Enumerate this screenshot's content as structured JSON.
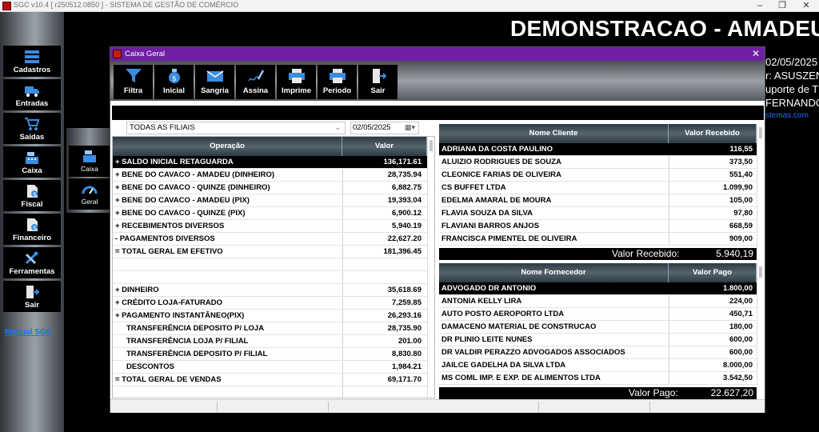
{
  "window": {
    "title": "SGC v10.4 [ r250512.0850 ] - SISTEMA DE GESTÃO DE COMÉRCIO"
  },
  "sidebar": {
    "items": [
      {
        "label": "Cadastros",
        "icon": "cadastros-icon"
      },
      {
        "label": "Entradas",
        "icon": "truck-icon"
      },
      {
        "label": "Saídas",
        "icon": "cart-icon"
      },
      {
        "label": "Caixa",
        "icon": "cash-register-icon"
      },
      {
        "label": "Fiscal",
        "icon": "fiscal-document-icon"
      },
      {
        "label": "Financeiro",
        "icon": "finance-document-icon"
      },
      {
        "label": "Ferramentas",
        "icon": "tools-icon"
      },
      {
        "label": "Sair",
        "icon": "exit-door-icon"
      }
    ],
    "manual_link": "Manual SGC"
  },
  "mini_panel": {
    "items": [
      {
        "label": "Caixa",
        "icon": "cash-register-icon"
      },
      {
        "label": "Geral",
        "icon": "gauge-icon"
      }
    ]
  },
  "background": {
    "title": "DEMONSTRACAO - AMADEU",
    "date_fragment": "02/05/2025",
    "user_fragment": "r: ASUSZEN",
    "support_fragment": "uporte de TI",
    "name_fragment": "FERNANDO",
    "link_fragment": "stemas.com"
  },
  "dialog": {
    "title": "Caixa Geral",
    "close_glyph": "✕",
    "toolbar": [
      {
        "label": "Filtra",
        "icon": "funnel-icon"
      },
      {
        "label": "Inicial",
        "icon": "money-bag-icon"
      },
      {
        "label": "Sangria",
        "icon": "envelope-money-icon"
      },
      {
        "label": "Assina",
        "icon": "signature-pen-icon"
      },
      {
        "label": "Imprime",
        "icon": "printer-icon"
      },
      {
        "label": "Periodo",
        "icon": "printer-period-icon"
      },
      {
        "label": "Sair",
        "icon": "exit-door-icon"
      }
    ],
    "filial_select": "TODAS AS FILIAIS",
    "date_value": "02/05/2025"
  },
  "operations": {
    "headers": {
      "operacao": "Operação",
      "valor": "Valor"
    },
    "rows": [
      {
        "label": "+ SALDO INICIAL RETAGUARDA",
        "value": "136,171.61",
        "selected": true
      },
      {
        "label": "+ BENE DO CAVACO - AMADEU (DINHEIRO)",
        "value": "28,735.94"
      },
      {
        "label": "+ BENE DO CAVACO - QUINZE (DINHEIRO)",
        "value": "6,882.75"
      },
      {
        "label": "+ BENE DO CAVACO - AMADEU (PIX)",
        "value": "19,393.04"
      },
      {
        "label": "+ BENE DO CAVACO - QUINZE (PIX)",
        "value": "6,900.12"
      },
      {
        "label": "+ RECEBIMENTOS DIVERSOS",
        "value": "5,940.19"
      },
      {
        "label": "- PAGAMENTOS DIVERSOS",
        "value": "22,627.20"
      },
      {
        "label": "= TOTAL GERAL EM EFETIVO",
        "value": "181,396.45"
      },
      {
        "label": "",
        "value": ""
      },
      {
        "label": "",
        "value": ""
      },
      {
        "label": "+ DINHEIRO",
        "value": "35,618.69"
      },
      {
        "label": "+ CRÉDITO LOJA-FATURADO",
        "value": "7,259.85"
      },
      {
        "label": "+ PAGAMENTO INSTANTÂNEO(PIX)",
        "value": "26,293.16"
      },
      {
        "label": "TRANSFERÊNCIA DEPOSITO P/ LOJA",
        "value": "28,735.90",
        "indent": true
      },
      {
        "label": "TRANSFERÊNCIA LOJA P/ FILIAL",
        "value": "201.00",
        "indent": true
      },
      {
        "label": "TRANSFERÊNCIA DEPOSITO P/ FILIAL",
        "value": "8,830.80",
        "indent": true
      },
      {
        "label": "DESCONTOS",
        "value": "1,984.21",
        "indent": true
      },
      {
        "label": "= TOTAL GERAL DE VENDAS",
        "value": "69,171.70"
      }
    ]
  },
  "clientes": {
    "headers": {
      "nome": "Nome Cliente",
      "valor": "Valor Recebido"
    },
    "rows": [
      {
        "name": "ADRIANA DA COSTA PAULINO",
        "value": "116,55",
        "selected": true
      },
      {
        "name": "ALUIZIO RODRIGUES DE SOUZA",
        "value": "373,50"
      },
      {
        "name": "CLEONICE FARIAS DE OLIVEIRA",
        "value": "551,40"
      },
      {
        "name": "CS BUFFET LTDA",
        "value": "1.099,90"
      },
      {
        "name": "EDELMA AMARAL DE MOURA",
        "value": "105,00"
      },
      {
        "name": "FLAVIA SOUZA DA SILVA",
        "value": "97,80"
      },
      {
        "name": "FLAVIANI BARROS ANJOS",
        "value": "668,59"
      },
      {
        "name": "FRANCISCA PIMENTEL DE OLIVEIRA",
        "value": "909,00"
      }
    ],
    "total_label": "Valor Recebido:",
    "total_value": "5.940,19"
  },
  "fornecedores": {
    "headers": {
      "nome": "Nome Fornecedor",
      "valor": "Valor Pago"
    },
    "rows": [
      {
        "name": "ADVOGADO DR ANTONIO",
        "value": "1.800,00",
        "selected": true
      },
      {
        "name": "ANTONIA KELLY LIRA",
        "value": "224,00"
      },
      {
        "name": "AUTO POSTO AEROPORTO LTDA",
        "value": "450,71"
      },
      {
        "name": "DAMACENO MATERIAL DE CONSTRUCAO",
        "value": "180,00"
      },
      {
        "name": "DR PLINIO LEITE NUNES",
        "value": "600,00"
      },
      {
        "name": "DR VALDIR PERAZZO ADVOGADOS ASSOCIADOS",
        "value": "600,00"
      },
      {
        "name": "JAILCE GADELHA DA SILVA LTDA",
        "value": "8.000,00"
      },
      {
        "name": "MS COML IMP. E EXP. DE ALIMENTOS LTDA",
        "value": "3.542,50"
      }
    ],
    "total_label": "Valor Pago:",
    "total_value": "22.627,20"
  },
  "colors": {
    "accent_titlebar": "#6e1fa3",
    "link": "#1a6fff",
    "selected_row": "#000000"
  }
}
